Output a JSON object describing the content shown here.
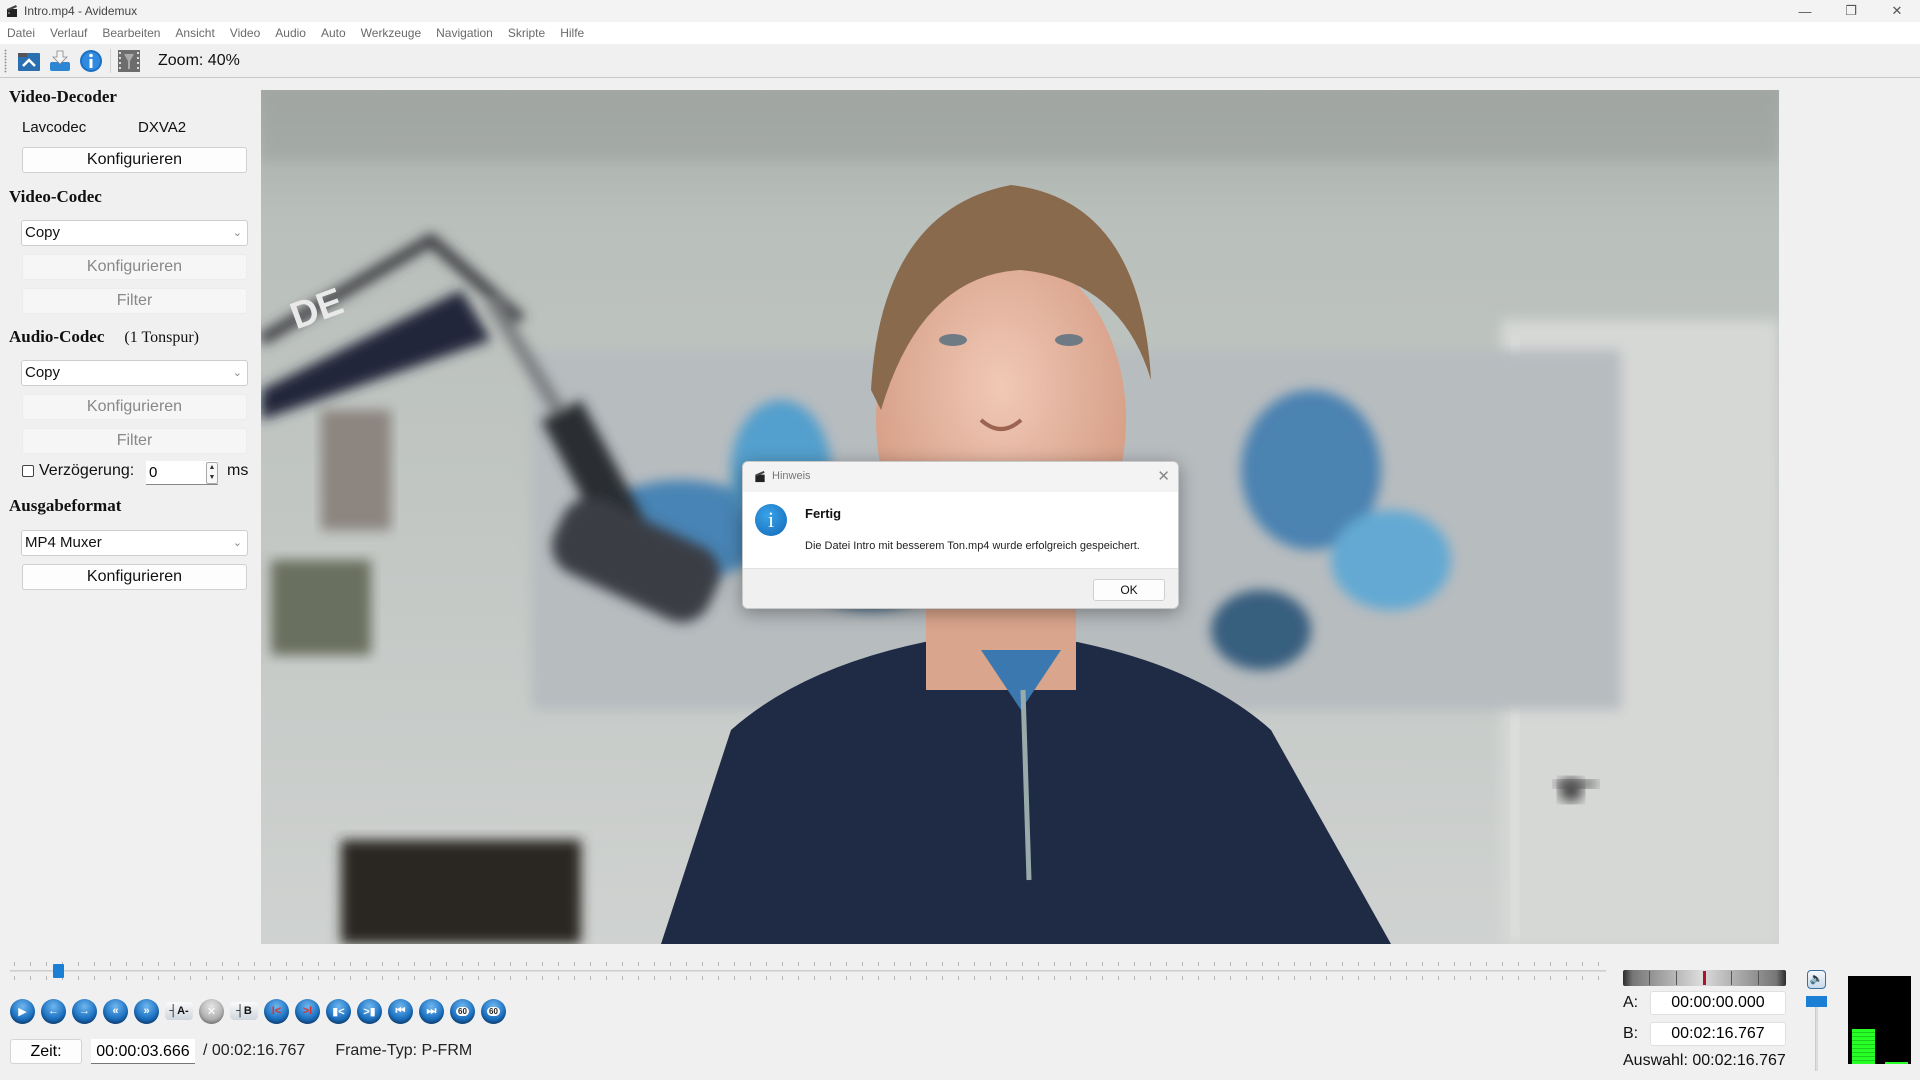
{
  "window": {
    "title": "Intro.mp4 - Avidemux",
    "controls": {
      "minimize": "—",
      "restore": "❐",
      "close": "✕"
    }
  },
  "menu": [
    "Datei",
    "Verlauf",
    "Bearbeiten",
    "Ansicht",
    "Video",
    "Audio",
    "Auto",
    "Werkzeuge",
    "Navigation",
    "Skripte",
    "Hilfe"
  ],
  "toolbar": {
    "icons": [
      "open-video-icon",
      "save-video-icon",
      "info-icon",
      "video-filter-icon"
    ],
    "zoom_label": "Zoom: 40%"
  },
  "left_panel": {
    "video_decoder": {
      "title": "Video-Decoder",
      "decoder_name": "Lavcodec",
      "decoder_hw": "DXVA2",
      "configure_label": "Konfigurieren"
    },
    "video_codec": {
      "title": "Video-Codec",
      "selected": "Copy",
      "configure_label": "Konfigurieren",
      "filter_label": "Filter"
    },
    "audio_codec": {
      "title": "Audio-Codec",
      "tracks": "(1 Tonspur)",
      "selected": "Copy",
      "configure_label": "Konfigurieren",
      "filter_label": "Filter",
      "delay_label": "Verzögerung:",
      "delay_checked": false,
      "delay_value": "0",
      "delay_unit": "ms"
    },
    "output_format": {
      "title": "Ausgabeformat",
      "selected": "MP4 Muxer",
      "configure_label": "Konfigurieren"
    }
  },
  "dialog": {
    "title": "Hinweis",
    "close": "✕",
    "icon": "i",
    "heading": "Fertig",
    "message": "Die Datei Intro mit besserem Ton.mp4 wurde erfolgreich gespeichert.",
    "ok_label": "OK"
  },
  "playback": {
    "position_fraction": 0.027,
    "buttons": [
      {
        "name": "play-icon",
        "glyph": "▶"
      },
      {
        "name": "previous-frame-icon",
        "glyph": "←"
      },
      {
        "name": "next-frame-icon",
        "glyph": "→"
      },
      {
        "name": "rewind-icon",
        "glyph": "«"
      },
      {
        "name": "fast-forward-icon",
        "glyph": "»"
      },
      {
        "name": "set-marker-a-icon",
        "glyph": "┤A-"
      },
      {
        "name": "clear-markers-icon",
        "glyph": "✕"
      },
      {
        "name": "set-marker-b-icon",
        "glyph": "┤B"
      },
      {
        "name": "previous-keyframe-icon",
        "glyph": "I<"
      },
      {
        "name": "next-keyframe-icon",
        "glyph": ">I"
      },
      {
        "name": "previous-black-frame-icon",
        "glyph": "▮<"
      },
      {
        "name": "next-black-frame-icon",
        "glyph": ">▮"
      },
      {
        "name": "go-to-first-frame-icon",
        "glyph": "⏮"
      },
      {
        "name": "go-to-last-frame-icon",
        "glyph": "⏭"
      },
      {
        "name": "back-60s-icon",
        "glyph": "60"
      },
      {
        "name": "forward-60s-icon",
        "glyph": "60"
      }
    ],
    "time_label": "Zeit:",
    "current_time": "00:00:03.666",
    "total_time": "/ 00:02:16.767",
    "frame_type": "Frame-Typ: P-FRM"
  },
  "selection": {
    "a_label": "A:",
    "a_time": "00:00:00.000",
    "b_label": "B:",
    "b_time": "00:02:16.767",
    "selection_text": "Auswahl: 00:02:16.767"
  },
  "audio": {
    "volume_fraction": 1.0,
    "meter_left": 0.4,
    "meter_right": 0.02,
    "meter_color": "#27ff27"
  }
}
